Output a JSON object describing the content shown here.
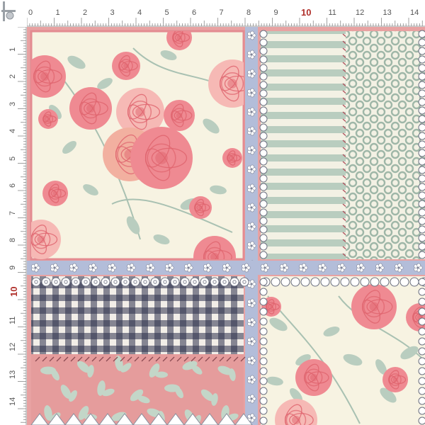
{
  "ruler": {
    "unit": "cm",
    "top_labels": [
      "0",
      "1",
      "2",
      "3",
      "4",
      "5",
      "6",
      "7",
      "8",
      "9",
      "10",
      "11",
      "12",
      "13",
      "14"
    ],
    "left_labels": [
      "1",
      "2",
      "3",
      "4",
      "5",
      "6",
      "7",
      "8",
      "9",
      "10",
      "11",
      "12",
      "13",
      "14"
    ],
    "highlight_label": "10"
  },
  "palette": {
    "cream": "#f7f3e2",
    "rose": "#ef8a92",
    "rose_dark": "#e0646e",
    "rose_light": "#f6b9b5",
    "sage": "#b9cdbf",
    "sage_dark": "#9db5a6",
    "blue_grey": "#b3bdd9",
    "pink_panel": "#e59c9c",
    "navy": "#2b2f4a",
    "lace": "#ffffff",
    "lace_outline": "#8a8f9e"
  },
  "panels": [
    {
      "name": "rose-bouquet-panel",
      "motif": "roses"
    },
    {
      "name": "striped-panel",
      "motif": "stripes"
    },
    {
      "name": "dotted-panel",
      "motif": "circles"
    },
    {
      "name": "gingham-panel",
      "motif": "gingham"
    },
    {
      "name": "leaf-panel",
      "motif": "leaves"
    },
    {
      "name": "rose-corner-panel",
      "motif": "roses"
    }
  ]
}
